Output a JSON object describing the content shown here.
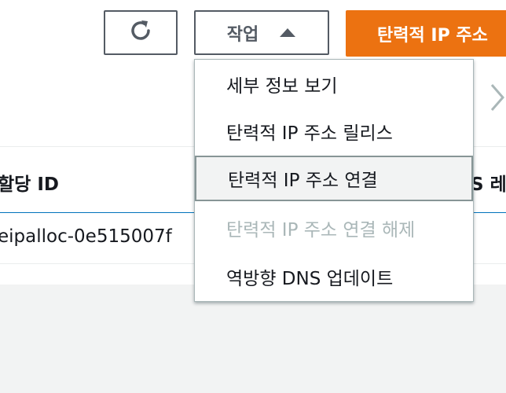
{
  "toolbar": {
    "refresh_icon": "refresh-icon",
    "actions_label": "작업",
    "actions_icon": "caret-up-icon",
    "primary_label": "탄력적 IP 주소"
  },
  "table": {
    "columns": [
      "할당 ID",
      "S 레"
    ],
    "rows": [
      {
        "allocation_id": "eipalloc-0e515007f"
      }
    ]
  },
  "actions_menu": {
    "items": [
      {
        "label": "세부 정보 보기",
        "disabled": false,
        "highlighted": false
      },
      {
        "label": "탄력적 IP 주소 릴리스",
        "disabled": false,
        "highlighted": false
      },
      {
        "label": "탄력적 IP 주소 연결",
        "disabled": false,
        "highlighted": true
      },
      {
        "label": "탄력적 IP 주소 연결 해제",
        "disabled": true,
        "highlighted": false
      },
      {
        "label": "역방향 DNS 업데이트",
        "disabled": false,
        "highlighted": false
      }
    ]
  },
  "pagination": {
    "next_icon": "chevron-right-icon"
  },
  "colors": {
    "primary": "#ec7211",
    "border": "#545b64",
    "disabled_text": "#aab7b8",
    "selected_row_border": "#0073bb"
  }
}
